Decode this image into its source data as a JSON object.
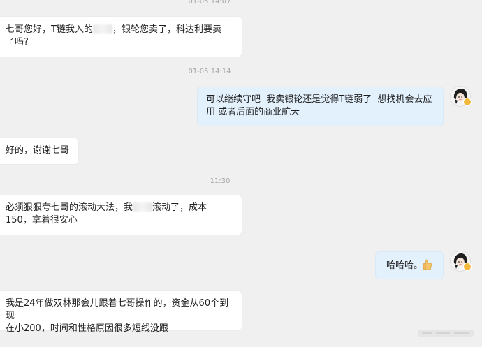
{
  "messages": [
    {
      "kind": "timestamp",
      "text": "01-05 14:07"
    },
    {
      "kind": "incoming",
      "parts": [
        "七哥您好，T链我入的",
        "，银轮您卖了，科达利要卖\n了吗?"
      ]
    },
    {
      "kind": "timestamp",
      "text": "01-05 14:14"
    },
    {
      "kind": "outgoing",
      "text": "可以继续守吧  我卖银轮还是觉得T链弱了  想找机会去应\n用 或者后面的商业航天"
    },
    {
      "kind": "incoming",
      "text": "好的，谢谢七哥"
    },
    {
      "kind": "timestamp",
      "text": "11:30"
    },
    {
      "kind": "incoming",
      "parts": [
        "必须狠狠夸七哥的滚动大法，我",
        "滚动了，成本\n150，拿着很安心"
      ]
    },
    {
      "kind": "outgoing",
      "text": "哈哈哈。"
    },
    {
      "kind": "incoming",
      "text": "我是24年做双林那会儿跟着七哥操作的，资金从60个到现\n在小200，时间和性格原因很多短线没跟"
    }
  ],
  "icons": {
    "avatar": "anime-girl-avatar-icon",
    "badge": "gold-verified-badge-icon",
    "emoji": "thumbs-up-emoji-icon",
    "watermark": "blurred-watermark"
  },
  "colors": {
    "background": "#f0f0f0",
    "incoming_bubble": "#ffffff",
    "outgoing_bubble": "#e3f1fd",
    "timestamp": "#a3a3a3"
  }
}
